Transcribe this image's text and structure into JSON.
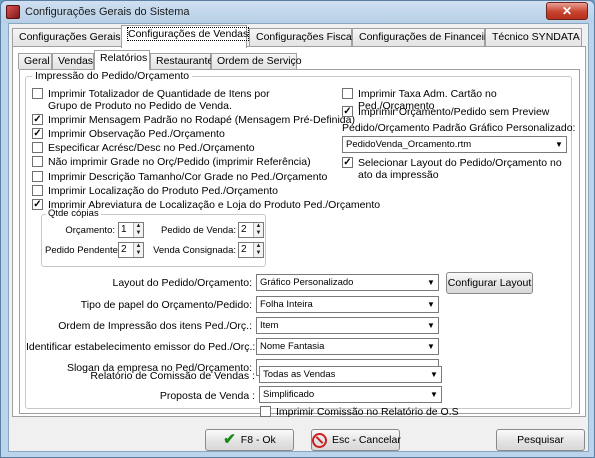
{
  "window": {
    "title": "Configurações Gerais do Sistema",
    "close_label": "✕"
  },
  "top_tabs": [
    {
      "label": "Configurações Gerais"
    },
    {
      "label": "Configurações de Vendas"
    },
    {
      "label": "Configurações Fiscais"
    },
    {
      "label": "Configurações de Financeiro"
    },
    {
      "label": "Técnico SYNDATA"
    }
  ],
  "sub_tabs": [
    {
      "label": "Geral"
    },
    {
      "label": "Vendas"
    },
    {
      "label": "Relatórios"
    },
    {
      "label": "Restaurante"
    },
    {
      "label": "Ordem de Serviço"
    }
  ],
  "group_title": "Impressão do Pedido/Orçamento",
  "left_checks": [
    {
      "label": "Imprimir Totalizador de Quantidade de Itens por\nGrupo de Produto no Pedido de Venda.",
      "checked": false
    },
    {
      "label": "Imprimir Mensagem Padrão no Rodapé (Mensagem Pré-Definida)",
      "checked": true
    },
    {
      "label": "Imprimir Observação Ped./Orçamento",
      "checked": true
    },
    {
      "label": "Especificar Acrésc/Desc no Ped./Orçamento",
      "checked": false
    },
    {
      "label": "Não imprimir Grade no Orç/Pedido (imprimir Referência)",
      "checked": false
    },
    {
      "label": "Imprimir Descrição Tamanho/Cor Grade no Ped./Orçamento",
      "checked": false
    },
    {
      "label": "Imprimir Localização do Produto Ped./Orçamento",
      "checked": false
    },
    {
      "label": "Imprimir Abreviatura de Localização e Loja do Produto Ped./Orçamento",
      "checked": true
    }
  ],
  "right_checks": {
    "taxa": {
      "label": "Imprimir Taxa Adm. Cartão no Ped./Orçamento",
      "checked": false
    },
    "preview": {
      "label": "Imprimir Orçamento/Pedido sem Preview",
      "checked": true
    },
    "layout_sel": {
      "label": "Selecionar Layout do Pedido/Orçamento no\nato da impressão",
      "checked": true
    }
  },
  "padrao_grafico": {
    "label": "Pedido/Orçamento Padrão Gráfico Personalizado:",
    "value": "PedidoVenda_Orcamento.rtm"
  },
  "qtde": {
    "title": "Qtde cópias",
    "orcamento": {
      "label": "Orçamento:",
      "value": "1"
    },
    "pedido_venda": {
      "label": "Pedido de Venda:",
      "value": "2"
    },
    "pedido_pendente": {
      "label": "Pedido Pendente:",
      "value": "2"
    },
    "venda_consignada": {
      "label": "Venda Consignada:",
      "value": "2"
    }
  },
  "fields": {
    "layout": {
      "label": "Layout do Pedido/Orçamento:",
      "value": "Gráfico Personalizado"
    },
    "tipo_papel": {
      "label": "Tipo de papel do Orçamento/Pedido:",
      "value": "Folha Inteira"
    },
    "ordem": {
      "label": "Ordem de Impressão dos itens Ped./Orç.:",
      "value": "Item"
    },
    "identificar": {
      "label": "Identificar estabelecimento emissor do Ped./Orç.:",
      "value": "Nome Fantasia"
    },
    "slogan": {
      "label": "Slogan da empresa no Ped/Orçamento:",
      "value": ""
    },
    "relatorio_comissao": {
      "label": "Relatório de Comissão de Vendas :",
      "value": "Todas as Vendas"
    },
    "proposta": {
      "label": "Proposta de Venda :",
      "value": "Simplificado"
    }
  },
  "imprimir_comissao": {
    "label": "Imprimir Comissão no Relatório de O.S",
    "checked": false
  },
  "buttons": {
    "configurar_layout": "Configurar Layout",
    "ok": "F8 - Ok",
    "cancelar": "Esc - Cancelar",
    "pesquisar": "Pesquisar"
  },
  "colors": {
    "titlebar": "#bcd4ea",
    "close": "#c7432e",
    "ok_icon": "#1a8a1a",
    "cancel_icon": "#cc1f1f"
  }
}
